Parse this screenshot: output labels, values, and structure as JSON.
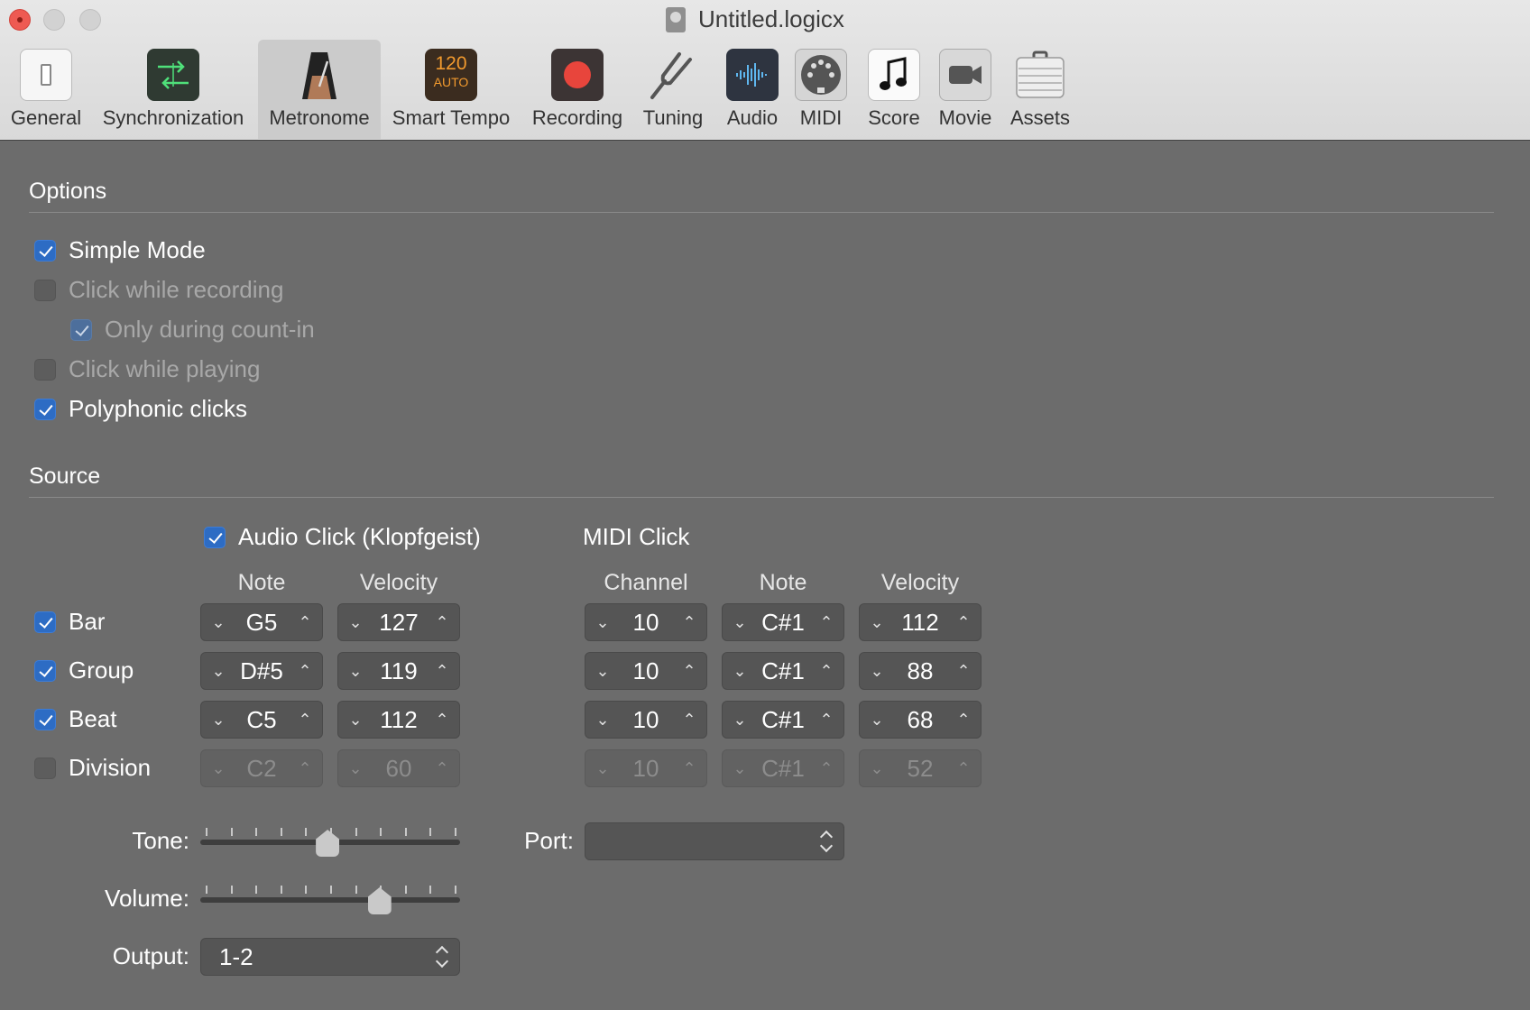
{
  "window": {
    "title": "Untitled.logicx"
  },
  "toolbar": {
    "items": [
      {
        "label": "General"
      },
      {
        "label": "Synchronization"
      },
      {
        "label": "Metronome"
      },
      {
        "label": "Smart Tempo",
        "badge_top": "120",
        "badge_bottom": "AUTO"
      },
      {
        "label": "Recording"
      },
      {
        "label": "Tuning"
      },
      {
        "label": "Audio"
      },
      {
        "label": "MIDI"
      },
      {
        "label": "Score"
      },
      {
        "label": "Movie"
      },
      {
        "label": "Assets"
      }
    ],
    "selected": "Metronome"
  },
  "options": {
    "title": "Options",
    "simple_mode": {
      "label": "Simple Mode",
      "checked": true
    },
    "click_while_recording": {
      "label": "Click while recording",
      "checked": false,
      "enabled": false
    },
    "only_during_countin": {
      "label": "Only during count-in",
      "checked": true,
      "enabled": false
    },
    "click_while_playing": {
      "label": "Click while playing",
      "checked": false,
      "enabled": false
    },
    "polyphonic_clicks": {
      "label": "Polyphonic clicks",
      "checked": true
    }
  },
  "source": {
    "title": "Source",
    "audio_click": {
      "label": "Audio Click (Klopfgeist)",
      "checked": true
    },
    "midi_click": {
      "label": "MIDI Click"
    },
    "headers": {
      "note": "Note",
      "velocity": "Velocity",
      "channel": "Channel",
      "midi_note": "Note",
      "midi_velocity": "Velocity"
    },
    "rows": [
      {
        "label": "Bar",
        "checked": true,
        "note": "G5",
        "velocity": "127",
        "channel": "10",
        "midi_note": "C#1",
        "midi_velocity": "112"
      },
      {
        "label": "Group",
        "checked": true,
        "note": "D#5",
        "velocity": "119",
        "channel": "10",
        "midi_note": "C#1",
        "midi_velocity": "88"
      },
      {
        "label": "Beat",
        "checked": true,
        "note": "C5",
        "velocity": "112",
        "channel": "10",
        "midi_note": "C#1",
        "midi_velocity": "68"
      },
      {
        "label": "Division",
        "checked": false,
        "note": "C2",
        "velocity": "60",
        "channel": "10",
        "midi_note": "C#1",
        "midi_velocity": "52"
      }
    ],
    "tone": {
      "label": "Tone:",
      "level": 0.49
    },
    "volume": {
      "label": "Volume:",
      "level": 0.69
    },
    "output": {
      "label": "Output:",
      "value": "1-2"
    },
    "port": {
      "label": "Port:",
      "value": ""
    }
  },
  "icons": {
    "general": "switch-icon",
    "synchronization": "sync-arrows-icon",
    "metronome": "metronome-icon",
    "smart_tempo": "tempo-badge-icon",
    "recording": "record-icon",
    "tuning": "tuning-fork-icon",
    "audio": "waveform-icon",
    "midi": "midi-connector-icon",
    "score": "music-note-icon",
    "movie": "video-camera-icon",
    "assets": "briefcase-icon"
  },
  "colors": {
    "accent": "#2d6cc4",
    "panel": "#6c6c6c",
    "record": "#e8453c",
    "tempo_orange": "#f29a2e"
  }
}
